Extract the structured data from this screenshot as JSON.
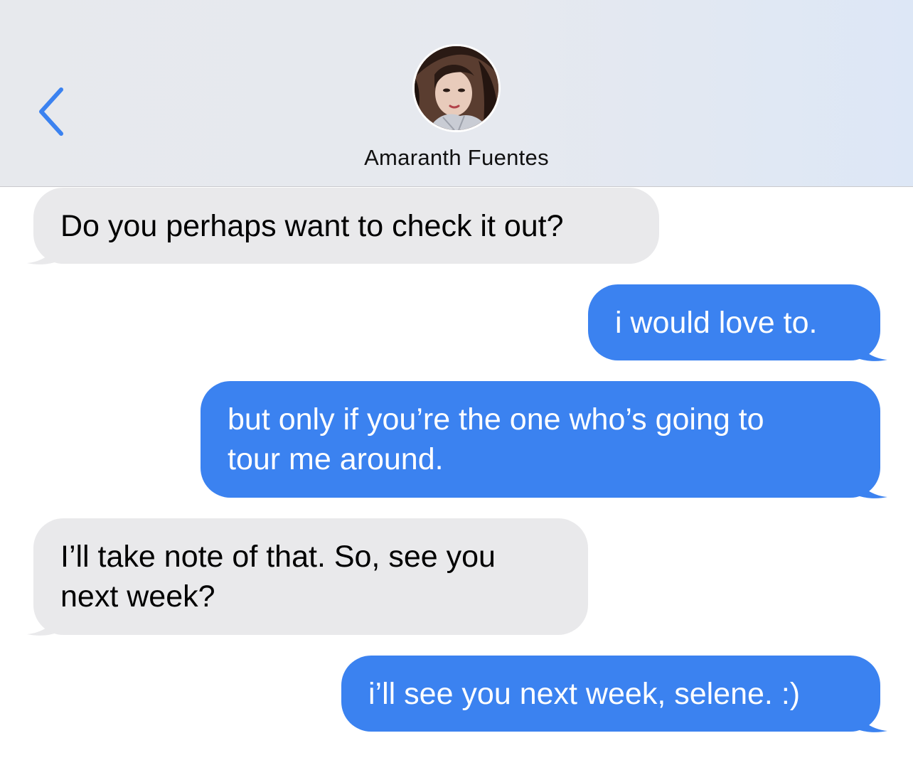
{
  "header": {
    "contact_name": "Amaranth Fuentes",
    "back_icon": "chevron-left-icon",
    "accent_color": "#3b82f0"
  },
  "messages": [
    {
      "direction": "incoming",
      "text": "Do you perhaps want to check it out?"
    },
    {
      "direction": "outgoing",
      "text": "i would love to."
    },
    {
      "direction": "outgoing",
      "text": "but only if you’re the one who’s going to\ntour me around."
    },
    {
      "direction": "incoming",
      "text": "I’ll take note of that. So, see you\nnext week?"
    },
    {
      "direction": "outgoing",
      "text": "i’ll see you next week, selene. :)"
    }
  ],
  "colors": {
    "incoming_bubble": "#e9e9eb",
    "outgoing_bubble": "#3b82f0",
    "header_background": "#e7e9ed"
  }
}
